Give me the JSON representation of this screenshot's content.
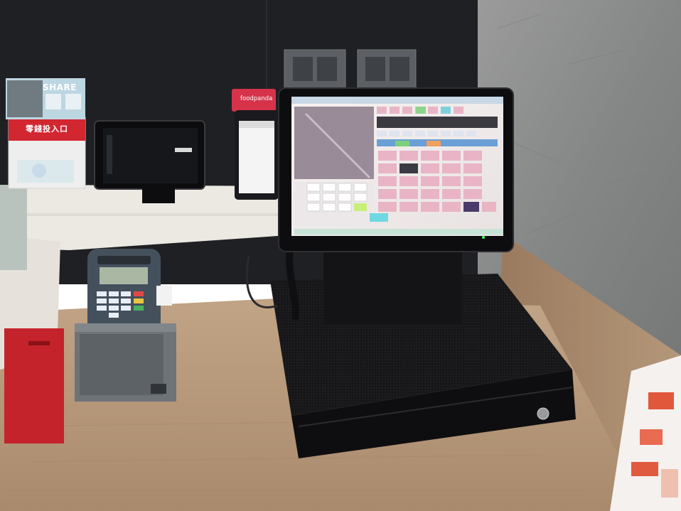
{
  "signs": {
    "share": "SHARE",
    "donation_box": "零錢投入口",
    "phone_stand": "foodpanda"
  },
  "colors": {
    "wall_dark": "#1f2023",
    "wall_concrete": "#8a8b8a",
    "counter_wood": "#b8987a",
    "shelf_white": "#ece9e3",
    "cash_drawer": "#111113",
    "pos_screen": "#f2ecea",
    "pos_key_pink": "#e9b4c6",
    "foodpanda_pink": "#d6334b",
    "donation_red": "#d22630"
  },
  "objects": {
    "pos_terminal": "pos-terminal",
    "cash_drawer": "cash-drawer",
    "card_reader": "card-reader",
    "receipt_printer": "receipt-printer",
    "tablet": "tablet",
    "phone": "phone",
    "donation_box": "donation-box"
  }
}
